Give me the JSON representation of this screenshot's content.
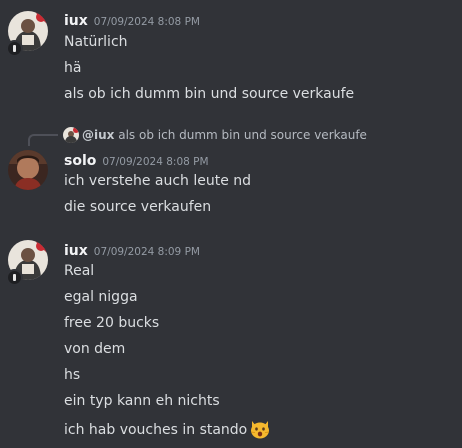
{
  "messages": [
    {
      "author": "iux",
      "timestamp": "07/09/2024 8:08 PM",
      "lines": [
        "Natürlich",
        "hä",
        "als ob ich dumm bin und source verkaufe"
      ]
    },
    {
      "reply": {
        "author": "@iux",
        "text": "als ob ich dumm bin und source verkaufe"
      },
      "author": "solo",
      "timestamp": "07/09/2024 8:08 PM",
      "lines": [
        "ich verstehe auch leute nd",
        "die source verkaufen"
      ]
    },
    {
      "author": "iux",
      "timestamp": "07/09/2024 8:09 PM",
      "lines": [
        "Real",
        "egal nigga",
        "free 20 bucks",
        "von dem",
        "hs",
        "ein typ kann eh nichts",
        "ich hab vouches in stando"
      ],
      "emoji": "hushed-cat-emoji"
    }
  ],
  "colors": {
    "background": "#313338",
    "username": "#f2f3f5",
    "timestamp": "#949ba4",
    "text": "#dbdee1"
  }
}
